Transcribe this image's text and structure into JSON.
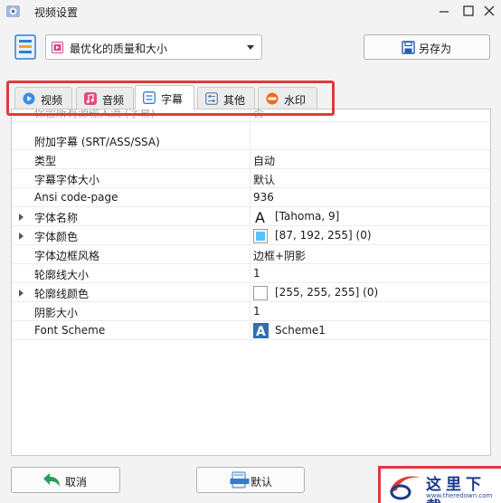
{
  "window": {
    "title": "视频设置"
  },
  "toolbar": {
    "preset_value": "最优化的质量和大小",
    "save_as_label": "另存为"
  },
  "tabs": [
    {
      "label": "视频",
      "icon": "video-icon",
      "active": false
    },
    {
      "label": "音频",
      "icon": "music-icon",
      "active": false
    },
    {
      "label": "字幕",
      "icon": "subtitle-icon",
      "active": true
    },
    {
      "label": "其他",
      "icon": "sliders-icon",
      "active": false
    },
    {
      "label": "水印",
      "icon": "new-badge-icon",
      "active": false
    }
  ],
  "properties": [
    {
      "name": "保留所有源输入流 (字幕)",
      "value": "否"
    },
    {
      "name": "附加字幕 (SRT/ASS/SSA)",
      "value": ""
    },
    {
      "name": "类型",
      "value": "自动"
    },
    {
      "name": "字幕字体大小",
      "value": "默认"
    },
    {
      "name": "Ansi code-page",
      "value": "936"
    },
    {
      "name": "字体名称",
      "value": "[Tahoma, 9]",
      "expandable": true,
      "value_icon": "font-a-icon"
    },
    {
      "name": "字体颜色",
      "value": "[87, 192, 255] (0)",
      "expandable": true,
      "value_icon": "color-swatch"
    },
    {
      "name": "字体边框风格",
      "value": "边框+阴影"
    },
    {
      "name": "轮廓线大小",
      "value": "1"
    },
    {
      "name": "轮廓线颜色",
      "value": "[255, 255, 255] (0)",
      "expandable": true,
      "value_icon": "color-swatch"
    },
    {
      "name": "阴影大小",
      "value": "1"
    },
    {
      "name": "Font Scheme",
      "value": "Scheme1",
      "value_icon": "scheme-a-icon"
    }
  ],
  "colors": {
    "font_color": "#57c0ff",
    "outline_color": "#ffffff",
    "highlight": "#e03a3a"
  },
  "buttons": {
    "cancel_label": "取消",
    "default_label": "默认"
  },
  "watermark": {
    "text": "这里下载",
    "url": "www.theredown.com"
  }
}
